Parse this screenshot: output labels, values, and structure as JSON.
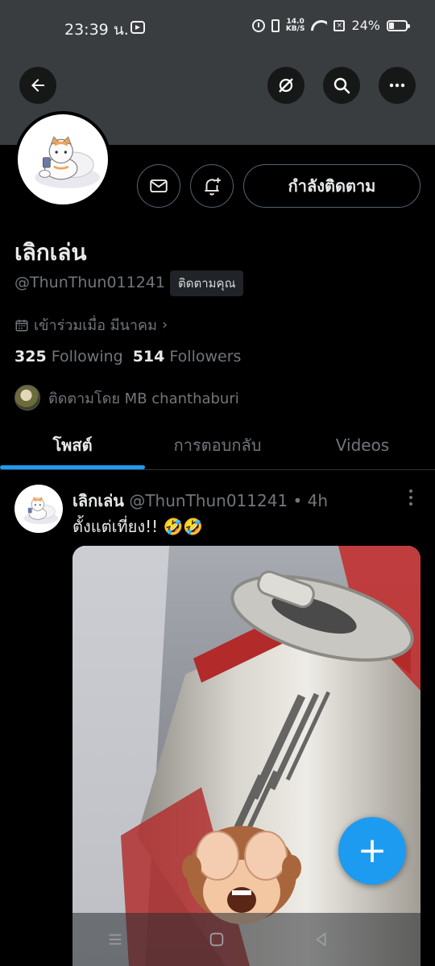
{
  "status_bar": {
    "time": "23:39 น.",
    "net_speed_value": "14.0",
    "net_speed_unit": "KB/S",
    "sim_status": "×",
    "battery": "24%"
  },
  "header": {
    "back_icon": "arrow-left-icon",
    "grok_icon": "grok-icon",
    "search_icon": "search-icon",
    "more_icon": "more-horizontal-icon"
  },
  "profile": {
    "display_name": "เลิกเล่น",
    "handle": "@ThunThun011241",
    "follows_you": "ติดตามคุณ",
    "joined": "เข้าร่วมเมื่อ มีนาคม",
    "following_count": "325",
    "following_label": "Following",
    "followers_count": "514",
    "followers_label": "Followers",
    "followed_by": "ติดตามโดย MB chanthaburi",
    "following_button": "กำลังติดตาม"
  },
  "tabs": [
    {
      "label": "โพสต์",
      "active": true
    },
    {
      "label": "การตอบกลับ",
      "active": false
    },
    {
      "label": "Videos",
      "active": false
    }
  ],
  "post": {
    "author_name": "เลิกเล่น",
    "author_meta": "@ThunThun011241 • 4h",
    "text": "ตั้งแต่เที่ยง!!",
    "emoji": "🤣🤣"
  },
  "colors": {
    "accent": "#1d9bf0",
    "banner": "#3a3d40",
    "muted_text": "#71767b",
    "border": "#536471"
  }
}
